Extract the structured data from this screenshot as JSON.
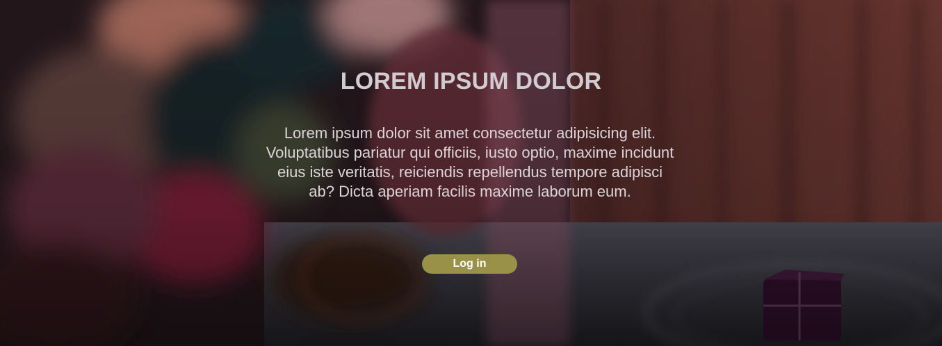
{
  "hero": {
    "title": "LOREM IPSUM DOLOR",
    "description": "Lorem ipsum dolor sit amet consectetur adipisicing elit. Voluptatibus pariatur qui officiis, iusto optio, maxime incidunt eius iste veritatis, reiciendis repellendus tempore adipisci ab? Dicta aperiam facilis maxime laborum eum.",
    "login_label": "Log in",
    "background_image": "dinner-table-photo",
    "colors": {
      "title": "#d2cbd0",
      "text": "#dcd4d8",
      "button_bg": "#9a9148",
      "button_text": "#ffffff"
    }
  }
}
